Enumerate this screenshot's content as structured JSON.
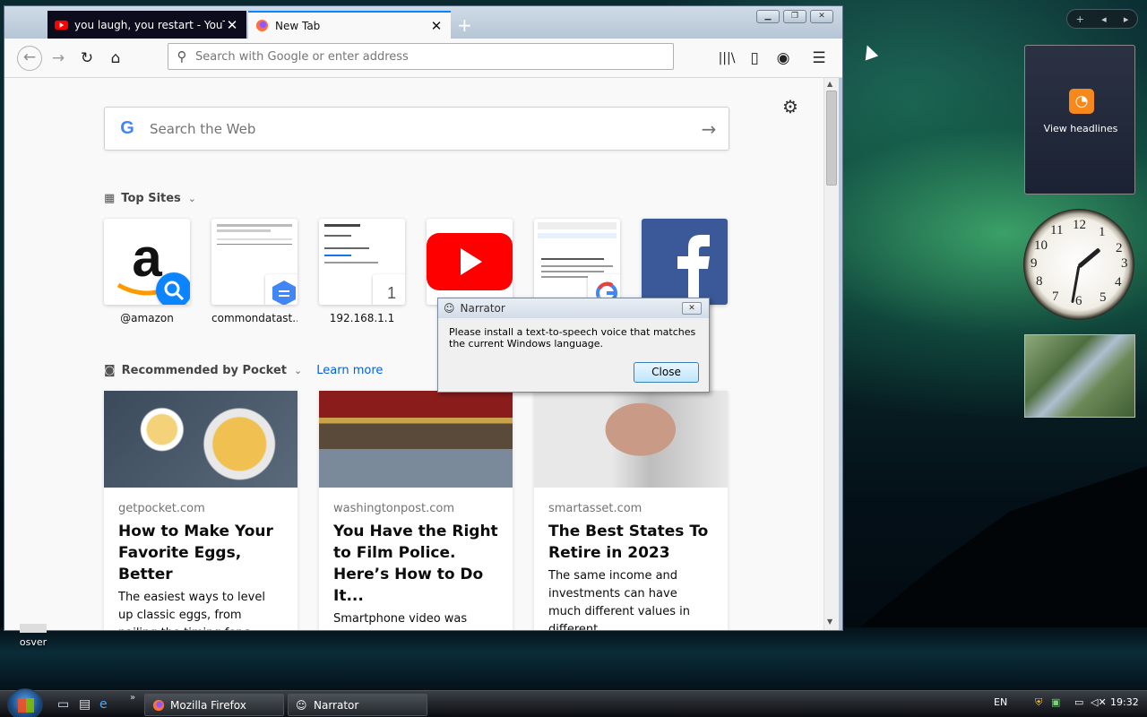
{
  "browser": {
    "tabs": [
      {
        "label": "you laugh, you restart - YouTube",
        "active": false
      },
      {
        "label": "New Tab",
        "active": true
      }
    ],
    "new_tab_symbol": "+",
    "url_placeholder": "Search with Google or enter address"
  },
  "newtab": {
    "search_placeholder": "Search the Web",
    "top_sites_title": "Top Sites",
    "top_sites": [
      {
        "label": "@amazon"
      },
      {
        "label": "commondatast..."
      },
      {
        "label": "192.168.1.1",
        "badge": "1"
      },
      {
        "label": ""
      },
      {
        "label": ""
      },
      {
        "label": ""
      }
    ],
    "pocket_title": "Recommended by Pocket",
    "learn_more": "Learn more",
    "cards": [
      {
        "source": "getpocket.com",
        "title": "How to Make Your Favorite Eggs, Better",
        "excerpt": "The easiest ways to level up classic eggs, from nailing the timing for a perfect jammy..."
      },
      {
        "source": "washingtonpost.com",
        "title": "You Have the Right to Film Police. Here’s How to Do It...",
        "excerpt": "Smartphone video was critical in convicting Derek Chauvin of murdering George Floyd..."
      },
      {
        "source": "smartasset.com",
        "title": "The Best States To Retire in 2023",
        "excerpt": "The same income and investments can have much different values in different..."
      }
    ]
  },
  "dialog": {
    "title": "Narrator",
    "message": "Please install a text-to-speech voice that matches the current Windows language.",
    "close_label": "Close"
  },
  "gadgets": {
    "feed_label": "View headlines",
    "clock_numbers": [
      "12",
      "1",
      "2",
      "3",
      "4",
      "5",
      "6",
      "7",
      "8",
      "9",
      "10",
      "11"
    ]
  },
  "desktop": {
    "icon_label": "osver"
  },
  "taskbar": {
    "items": [
      {
        "label": "Mozilla Firefox"
      },
      {
        "label": "Narrator"
      }
    ],
    "language": "EN",
    "time": "19:32"
  },
  "colors": {
    "firefox_accent": "#0a84ff",
    "pocket_link": "#0060df",
    "youtube_red": "#ff0000",
    "facebook_blue": "#3b5998",
    "amazon_orange": "#ff9900"
  }
}
